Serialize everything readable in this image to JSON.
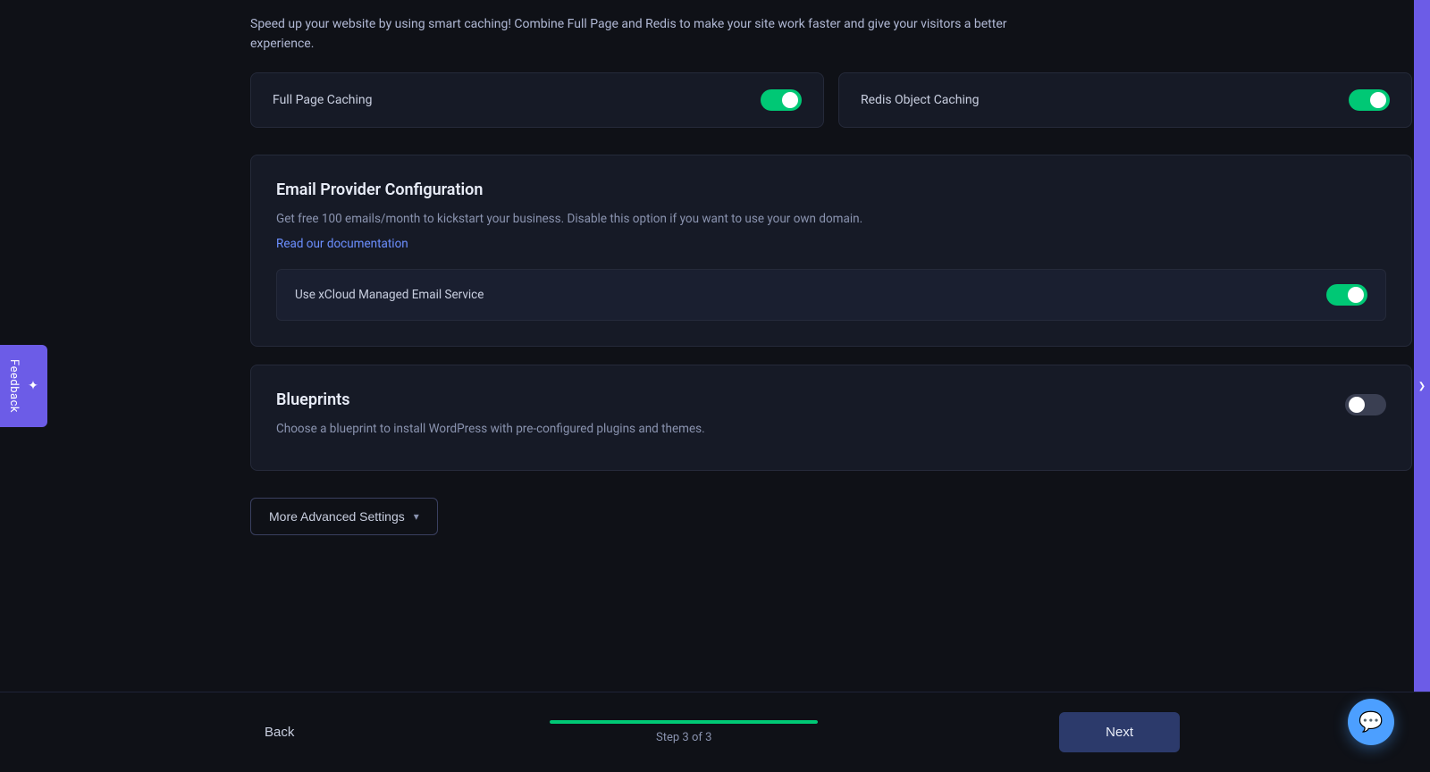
{
  "feedback": {
    "label": "Feedback",
    "icon": "✦"
  },
  "right_panel": {
    "chevron": "❯"
  },
  "top_section": {
    "description": "Speed up your website by using smart caching! Combine Full Page and Redis to make your site work faster and give your visitors a better experience."
  },
  "caching": {
    "full_page": {
      "label": "Full Page Caching",
      "enabled": true
    },
    "redis": {
      "label": "Redis Object Caching",
      "enabled": true
    }
  },
  "email_section": {
    "title": "Email Provider Configuration",
    "description": "Get free 100 emails/month to kickstart your business. Disable this option if you want to use your own domain.",
    "link_text": "Read our documentation",
    "toggle_label": "Use xCloud Managed Email Service",
    "enabled": true
  },
  "blueprints_section": {
    "title": "Blueprints",
    "description": "Choose a blueprint to install WordPress with pre-configured plugins and themes.",
    "enabled": false
  },
  "advanced": {
    "button_label": "More Advanced Settings",
    "chevron": "▾"
  },
  "footer": {
    "back_label": "Back",
    "next_label": "Next",
    "step_text": "Step 3 of 3",
    "progress_percent": 100
  },
  "chat": {
    "icon": "💬"
  }
}
